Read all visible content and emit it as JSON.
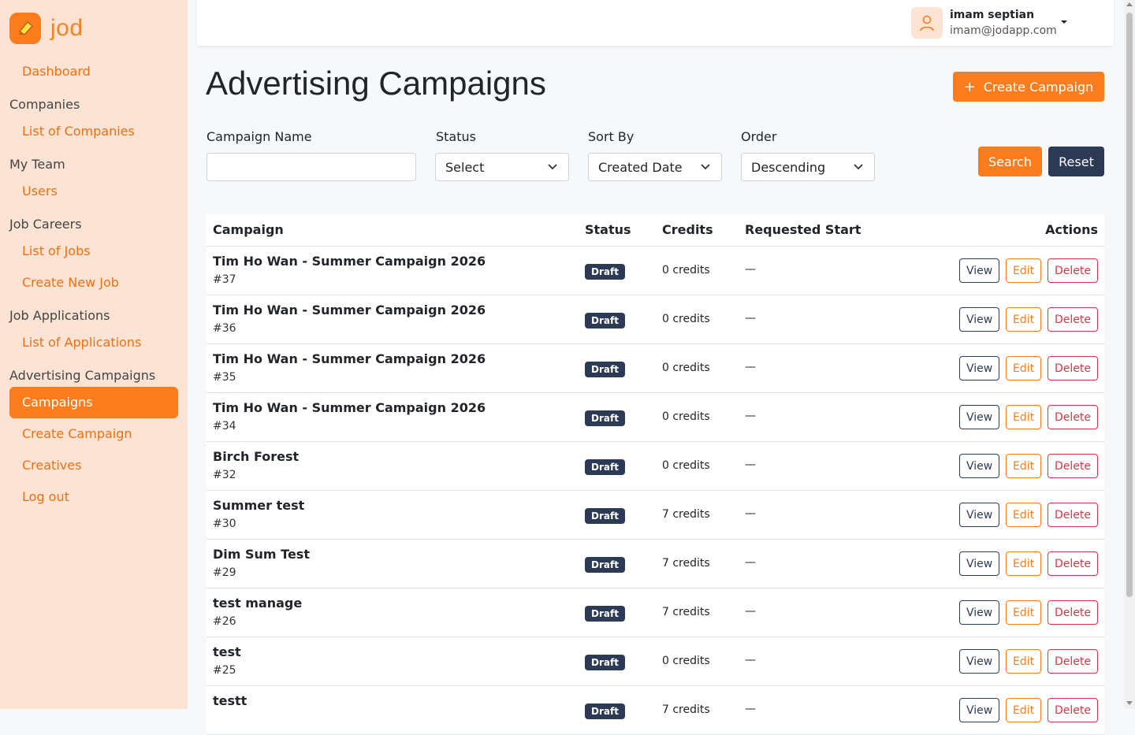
{
  "brand": {
    "name": "jod",
    "accent": "#fb7d1e",
    "dark": "#2d3a55",
    "danger": "#dc3545",
    "sidebar_bg": "#fde3d3"
  },
  "sidebar": {
    "dashboard": "Dashboard",
    "sections": [
      {
        "title": "Companies",
        "items": [
          "List of Companies"
        ]
      },
      {
        "title": "My Team",
        "items": [
          "Users"
        ]
      },
      {
        "title": "Job Careers",
        "items": [
          "List of Jobs",
          "Create New Job"
        ]
      },
      {
        "title": "Job Applications",
        "items": [
          "List of Applications"
        ]
      },
      {
        "title": "Advertising Campaigns",
        "items": [
          "Campaigns",
          "Create Campaign",
          "Creatives",
          "Log out"
        ]
      }
    ],
    "active_item": "Campaigns"
  },
  "user": {
    "name": "imam septian",
    "email": "imam@jodapp.com",
    "avatar_icon": "user-icon"
  },
  "page": {
    "title": "Advertising Campaigns",
    "create_button": "Create Campaign"
  },
  "filters": {
    "campaign_name": {
      "label": "Campaign Name",
      "value": ""
    },
    "status": {
      "label": "Status",
      "value": "Select"
    },
    "sort_by": {
      "label": "Sort By",
      "value": "Created Date"
    },
    "order": {
      "label": "Order",
      "value": "Descending"
    },
    "search_button": "Search",
    "reset_button": "Reset"
  },
  "table": {
    "headers": [
      "Campaign",
      "Status",
      "Credits",
      "Requested Start",
      "Actions"
    ],
    "action_labels": {
      "view": "View",
      "edit": "Edit",
      "delete": "Delete"
    },
    "rows": [
      {
        "name": "Tim Ho Wan - Summer Campaign 2026",
        "id": "#37",
        "status": "Draft",
        "credits": "0 credits",
        "start": "—"
      },
      {
        "name": "Tim Ho Wan - Summer Campaign 2026",
        "id": "#36",
        "status": "Draft",
        "credits": "0 credits",
        "start": "—"
      },
      {
        "name": "Tim Ho Wan - Summer Campaign 2026",
        "id": "#35",
        "status": "Draft",
        "credits": "0 credits",
        "start": "—"
      },
      {
        "name": "Tim Ho Wan - Summer Campaign 2026",
        "id": "#34",
        "status": "Draft",
        "credits": "0 credits",
        "start": "—"
      },
      {
        "name": "Birch Forest",
        "id": "#32",
        "status": "Draft",
        "credits": "0 credits",
        "start": "—"
      },
      {
        "name": "Summer test",
        "id": "#30",
        "status": "Draft",
        "credits": "7 credits",
        "start": "—"
      },
      {
        "name": "Dim Sum Test",
        "id": "#29",
        "status": "Draft",
        "credits": "7 credits",
        "start": "—"
      },
      {
        "name": "test manage",
        "id": "#26",
        "status": "Draft",
        "credits": "7 credits",
        "start": "—"
      },
      {
        "name": "test",
        "id": "#25",
        "status": "Draft",
        "credits": "0 credits",
        "start": "—"
      },
      {
        "name": "testt",
        "id": "",
        "status": "Draft",
        "credits": "7 credits",
        "start": "—"
      }
    ]
  }
}
